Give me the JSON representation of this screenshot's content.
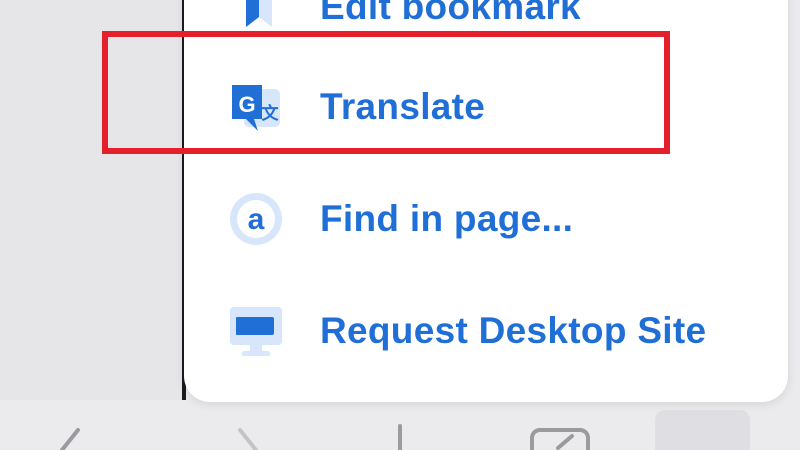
{
  "menu": {
    "items": [
      {
        "label": "Edit bookmark",
        "icon": "bookmark-icon"
      },
      {
        "label": "Translate",
        "icon": "translate-icon"
      },
      {
        "label": "Find in page...",
        "icon": "find-in-page-icon"
      },
      {
        "label": "Request Desktop Site",
        "icon": "desktop-site-icon"
      }
    ]
  },
  "toolbar": {
    "icons": [
      "back-icon",
      "forward-icon",
      "share-icon",
      "tabs-icon",
      "more-icon"
    ]
  },
  "colors": {
    "accent": "#1f6fd6",
    "icon_light": "#d7e6fb",
    "highlight": "#e3202b"
  }
}
